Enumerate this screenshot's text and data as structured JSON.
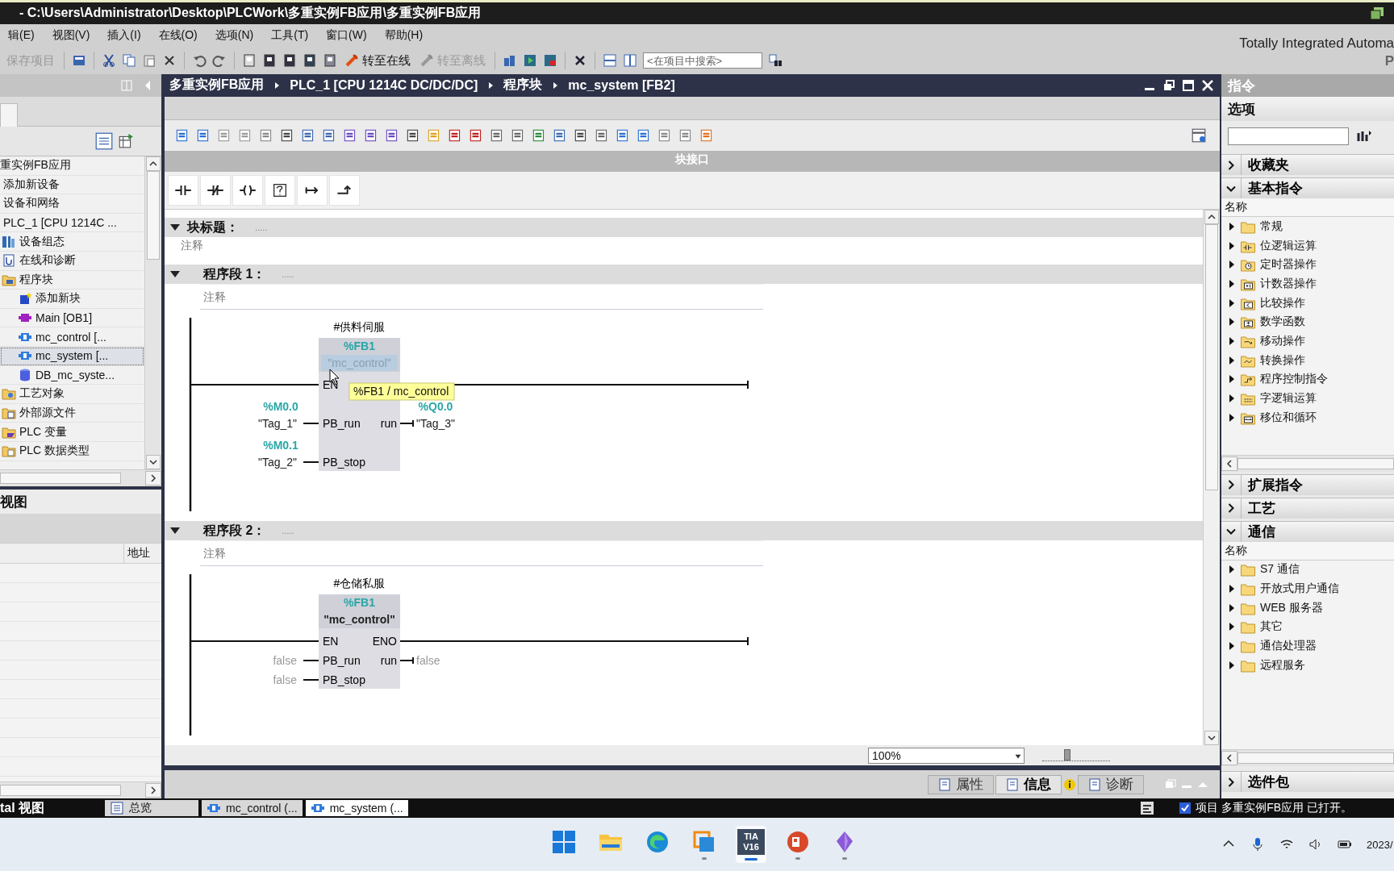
{
  "title_bar": {
    "title": "-  C:\\Users\\Administrator\\Desktop\\PLCWork\\多重实例FB应用\\多重实例FB应用"
  },
  "menu": [
    "辑(E)",
    "视图(V)",
    "插入(I)",
    "在线(O)",
    "选项(N)",
    "工具(T)",
    "窗口(W)",
    "帮助(H)"
  ],
  "brand": {
    "line_1": "Totally Integrated Automa",
    "line_2": "P"
  },
  "toolbar": {
    "save": {
      "label": "保存项目",
      "disabled": true
    },
    "go_online": {
      "label": "转至在线",
      "disabled": false
    },
    "go_offline": {
      "label": "转至离线",
      "disabled": true
    },
    "search": {
      "placeholder": "<在项目中搜索>"
    }
  },
  "project_tree": {
    "items": [
      {
        "label": "重实例FB应用",
        "selected": false,
        "children": [
          {
            "label": "添加新设备",
            "selected": false
          },
          {
            "label": "设备和网络",
            "selected": false
          },
          {
            "label": "PLC_1 [CPU 1214C ...",
            "selected": false,
            "children": [
              {
                "label": "设备组态",
                "kind": "config",
                "selected": false
              },
              {
                "label": "在线和诊断",
                "kind": "online",
                "selected": false
              },
              {
                "label": "程序块",
                "kind": "blocks",
                "selected": false,
                "children": [
                  {
                    "label": "添加新块",
                    "kind": "add",
                    "selected": false
                  },
                  {
                    "label": "Main [OB1]",
                    "kind": "ob",
                    "selected": false
                  },
                  {
                    "label": "mc_control [...",
                    "kind": "fb",
                    "selected": false
                  },
                  {
                    "label": "mc_system [...",
                    "kind": "fb",
                    "selected": true
                  },
                  {
                    "label": "DB_mc_syste...",
                    "kind": "db",
                    "selected": false
                  }
                ]
              },
              {
                "label": "工艺对象",
                "kind": "tech",
                "selected": false
              },
              {
                "label": "外部源文件",
                "kind": "source",
                "selected": false
              },
              {
                "label": "PLC 变量",
                "kind": "tags",
                "selected": false
              },
              {
                "label": "PLC 数据类型",
                "kind": "types",
                "selected": false
              }
            ]
          }
        ]
      }
    ]
  },
  "details_view": {
    "title": "视图",
    "address_column": "地址"
  },
  "editor": {
    "breadcrumb": [
      "多重实例FB应用",
      "PLC_1 [CPU 1214C DC/DC/DC]",
      "程序块",
      "mc_system [FB2]"
    ],
    "interface_bar": "块接口",
    "block_title": {
      "label": "块标题：",
      "dots": ".....",
      "comment": "注释",
      "expanded": true
    },
    "networks": [
      {
        "title": "程序段 1：",
        "dots": ".....",
        "expanded": true,
        "comment": "注释",
        "instance": "#供料伺服",
        "block_address": "%FB1",
        "block_name": "\"mc_control\"",
        "name_selected": true,
        "en": "EN",
        "tooltip": "%FB1 / mc_control",
        "inputs": [
          {
            "pin": "PB_run",
            "address": "%M0.0",
            "operand": "\"Tag_1\"",
            "kind": "tag"
          },
          {
            "pin": "PB_stop",
            "address": "%M0.1",
            "operand": "\"Tag_2\"",
            "kind": "tag"
          }
        ],
        "outputs": [
          {
            "pin": "run",
            "address": "%Q0.0",
            "operand": "\"Tag_3\"",
            "kind": "tag"
          }
        ]
      },
      {
        "title": "程序段 2：",
        "dots": ".....",
        "expanded": true,
        "comment": "注释",
        "instance": "#仓储私服",
        "block_address": "%FB1",
        "block_name": "\"mc_control\"",
        "name_selected": false,
        "en": "EN",
        "eno": "ENO",
        "inputs": [
          {
            "pin": "PB_run",
            "operand": "false",
            "kind": "constant"
          },
          {
            "pin": "PB_stop",
            "operand": "false",
            "kind": "constant"
          }
        ],
        "outputs": [
          {
            "pin": "run",
            "operand": "false",
            "kind": "constant"
          }
        ]
      }
    ],
    "zoom": "100%",
    "zoom_slider": {
      "level": 0.35
    }
  },
  "inspector_tabs": [
    {
      "label": "属性",
      "selected": false
    },
    {
      "label": "信息",
      "selected": true
    },
    {
      "label": "诊断",
      "selected": false
    }
  ],
  "task_card": {
    "title": "指令",
    "options_label": "选项",
    "sections": [
      {
        "label": "收藏夹",
        "expanded": false
      },
      {
        "label": "基本指令",
        "expanded": true,
        "column": "名称",
        "items": [
          {
            "label": "常规",
            "kind": "plain"
          },
          {
            "label": "位逻辑运算",
            "kind": "bit"
          },
          {
            "label": "定时器操作",
            "kind": "timer"
          },
          {
            "label": "计数器操作",
            "kind": "counter"
          },
          {
            "label": "比较操作",
            "kind": "compare"
          },
          {
            "label": "数学函数",
            "kind": "math"
          },
          {
            "label": "移动操作",
            "kind": "move"
          },
          {
            "label": "转换操作",
            "kind": "convert"
          },
          {
            "label": "程序控制指令",
            "kind": "control"
          },
          {
            "label": "字逻辑运算",
            "kind": "word"
          },
          {
            "label": "移位和循环",
            "kind": "shift"
          }
        ]
      },
      {
        "label": "扩展指令",
        "expanded": false
      },
      {
        "label": "工艺",
        "expanded": false
      },
      {
        "label": "通信",
        "expanded": true,
        "column": "名称",
        "items": [
          {
            "label": "S7 通信",
            "kind": "plain"
          },
          {
            "label": "开放式用户通信",
            "kind": "plain"
          },
          {
            "label": "WEB 服务器",
            "kind": "plain"
          },
          {
            "label": "其它",
            "kind": "plain"
          },
          {
            "label": "通信处理器",
            "kind": "plain"
          },
          {
            "label": "远程服务",
            "kind": "plain"
          }
        ]
      }
    ],
    "footer_section": {
      "label": "选件包",
      "expanded": false
    }
  },
  "status_bar": {
    "portal_view": "tal 视图",
    "tabs": [
      {
        "label": "总览",
        "kind": "overview",
        "selected": false
      },
      {
        "label": "mc_control (...",
        "kind": "fb",
        "selected": false
      },
      {
        "label": "mc_system (...",
        "kind": "fb",
        "selected": true
      }
    ],
    "message": {
      "checked": true,
      "text": "项目 多重实例FB应用 已打开。"
    }
  },
  "taskbar": {
    "apps": [
      {
        "kind": "start",
        "active": false,
        "running": false
      },
      {
        "kind": "explorer",
        "active": false,
        "running": false
      },
      {
        "kind": "edge",
        "active": false,
        "running": false
      },
      {
        "kind": "remote",
        "active": false,
        "running": true
      },
      {
        "kind": "tia",
        "active": true,
        "running": true,
        "line_1": "TIA",
        "line_2": "V16"
      },
      {
        "kind": "slides",
        "active": false,
        "running": true
      },
      {
        "kind": "gem",
        "active": false,
        "running": true
      }
    ],
    "clock": "2023/"
  }
}
